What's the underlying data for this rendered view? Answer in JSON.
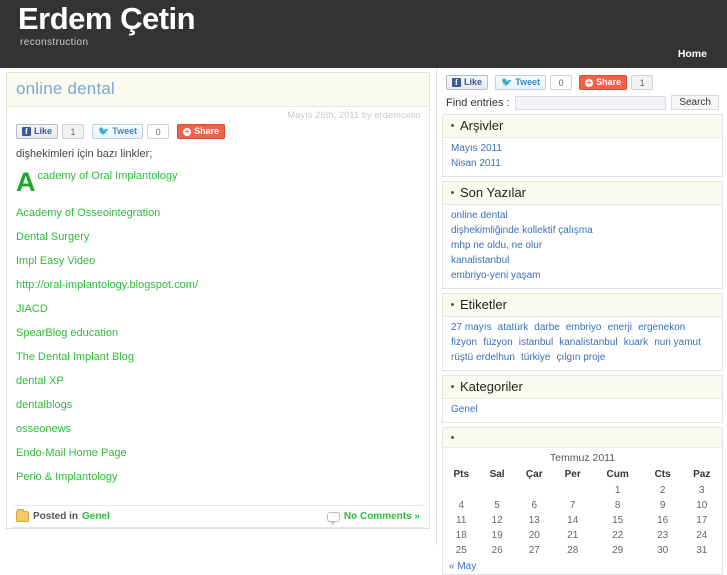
{
  "header": {
    "title": "Erdem Çetin",
    "tagline": "reconstruction",
    "nav": [
      {
        "label": "Home"
      }
    ]
  },
  "post": {
    "title": "online dental",
    "meta": "Mayıs 26th, 2011 by erdemcetin",
    "intro": "dişhekimleri için bazı linkler;",
    "social": {
      "like_label": "Like",
      "like_count": "1",
      "tweet_label": "Tweet",
      "tweet_count": "0",
      "share_label": "Share"
    },
    "dropcap": "A",
    "first_link_rest": "cademy of Oral Implantology",
    "links": [
      {
        "label": "Academy of Osseointegration"
      },
      {
        "label": "Dental Surgery"
      },
      {
        "label": "Impl Easy Video"
      },
      {
        "label": "http://oral-implantology.blogspot.com/"
      },
      {
        "label": "JIACD"
      },
      {
        "label": "SpearBlog education"
      },
      {
        "label": "The Dental Implant Blog"
      },
      {
        "label": "dental XP"
      },
      {
        "label": "dentalblogs"
      },
      {
        "label": "osseonews"
      },
      {
        "label": "Endo-Mail Home Page"
      },
      {
        "label": "Perio & Implantology"
      }
    ],
    "footer": {
      "posted_in_label": "Posted in",
      "category": "Genel",
      "comments": "No Comments »"
    }
  },
  "sidebar": {
    "social": {
      "like_label": "Like",
      "tweet_label": "Tweet",
      "tweet_count": "0",
      "share_label": "Share",
      "share_count": "1"
    },
    "search": {
      "label": "Find entries :",
      "value": "",
      "placeholder": "",
      "button": "Search"
    },
    "widgets": [
      {
        "title": "Arşivler",
        "items": [
          {
            "label": "Mayıs 2011"
          },
          {
            "label": "Nisan 2011"
          }
        ]
      },
      {
        "title": "Son Yazılar",
        "items": [
          {
            "label": "online dental"
          },
          {
            "label": "dişhekimliğinde kollektif çalışma"
          },
          {
            "label": "mhp ne oldu, ne olur"
          },
          {
            "label": "kanalistanbul"
          },
          {
            "label": "embriyo-yeni yaşam"
          }
        ]
      },
      {
        "title": "Etiketler",
        "tags": [
          "27 mayıs",
          "atatürk",
          "darbe",
          "embriyo",
          "enerji",
          "ergenekon",
          "fizyon",
          "füzyon",
          "istanbul",
          "kanalistanbul",
          "kuark",
          "nuri yamut",
          "rüştü erdelhun",
          "türkiye",
          "çılgın proje"
        ]
      },
      {
        "title": "Kategoriler",
        "items": [
          {
            "label": "Genel"
          }
        ]
      }
    ],
    "calendar": {
      "caption": "Temmuz 2011",
      "weekdays": [
        "Pts",
        "Sal",
        "Çar",
        "Per",
        "Cum",
        "Cts",
        "Paz"
      ],
      "weeks": [
        [
          "",
          "",
          "",
          "",
          "1",
          "2",
          "3"
        ],
        [
          "4",
          "5",
          "6",
          "7",
          "8",
          "9",
          "10"
        ],
        [
          "11",
          "12",
          "13",
          "14",
          "15",
          "16",
          "17"
        ],
        [
          "18",
          "19",
          "20",
          "21",
          "22",
          "23",
          "24"
        ],
        [
          "25",
          "26",
          "27",
          "28",
          "29",
          "30",
          "31"
        ]
      ],
      "prev_label": "« May"
    }
  },
  "colors": {
    "header_bg": "#333333",
    "link_green": "#2dbd3a",
    "link_blue": "#3b6fb8",
    "title_blue": "#7ba7d7",
    "widget_head_bg": "#fbfaef",
    "share_orange": "#f4614a"
  }
}
